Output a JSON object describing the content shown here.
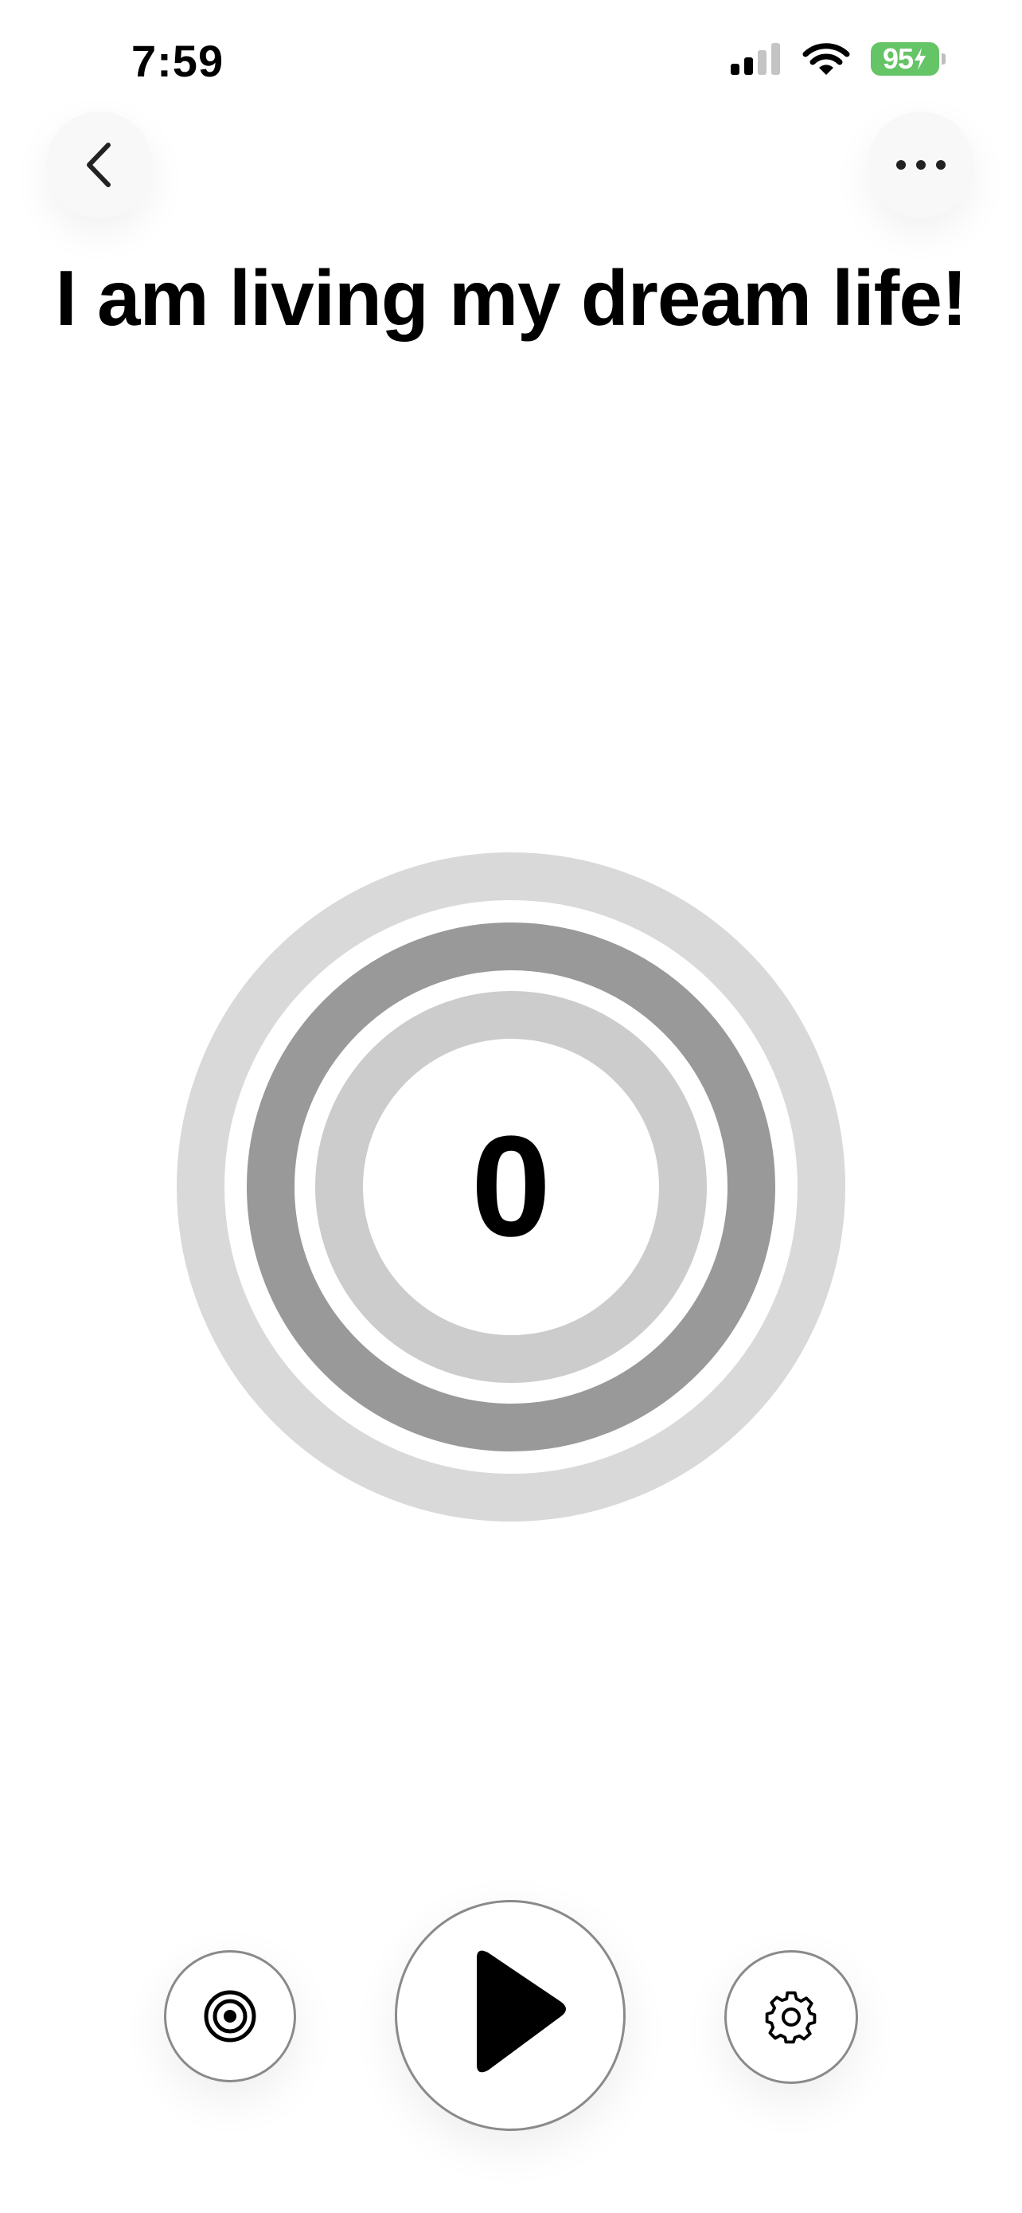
{
  "status_bar": {
    "time": "7:59",
    "battery_level": "95",
    "battery_color": "#65c466",
    "icons": [
      "cellular-signal-icon",
      "wifi-icon",
      "battery-charging-icon"
    ]
  },
  "header": {
    "back_icon": "chevron-left-icon",
    "more_icon": "ellipsis-icon"
  },
  "affirmation": {
    "title": "I am living my dream life!"
  },
  "counter": {
    "value": "0",
    "ring_colors": [
      "#d9d9d9",
      "#999999",
      "#cccccc"
    ]
  },
  "controls": {
    "left_icon": "target-icon",
    "center_icon": "play-icon",
    "right_icon": "gear-icon"
  }
}
